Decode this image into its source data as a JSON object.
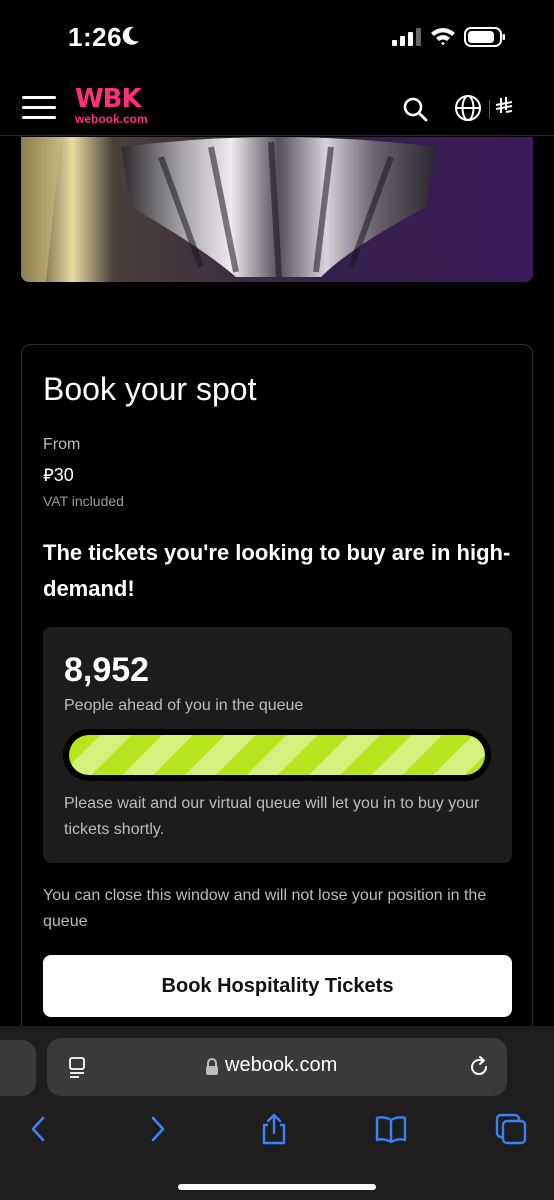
{
  "status_bar": {
    "time": "1:26"
  },
  "header": {
    "logo_mark": "WBK",
    "logo_domain": "webook.com",
    "currency_symbol": "⃁"
  },
  "card": {
    "title": "Book your spot",
    "from_label": "From",
    "price": "⃁30",
    "vat_label": "VAT included",
    "demand_message": "The tickets you're looking to buy are in high-demand!",
    "queue": {
      "count": "8,952",
      "label": "People ahead of you in the queue",
      "progress_percent": 100,
      "wait_message": "Please wait and our virtual queue will let you in to buy your tickets shortly."
    },
    "close_note": "You can close this window and will not lose your position in the queue",
    "book_button_label": "Book Hospitality Tickets"
  },
  "browser": {
    "url": "webook.com"
  },
  "colors": {
    "brand": "#ff2f7e",
    "progress_a": "#b5e51d",
    "progress_b": "#d5f07d",
    "browser_accent": "#3a82f7"
  }
}
